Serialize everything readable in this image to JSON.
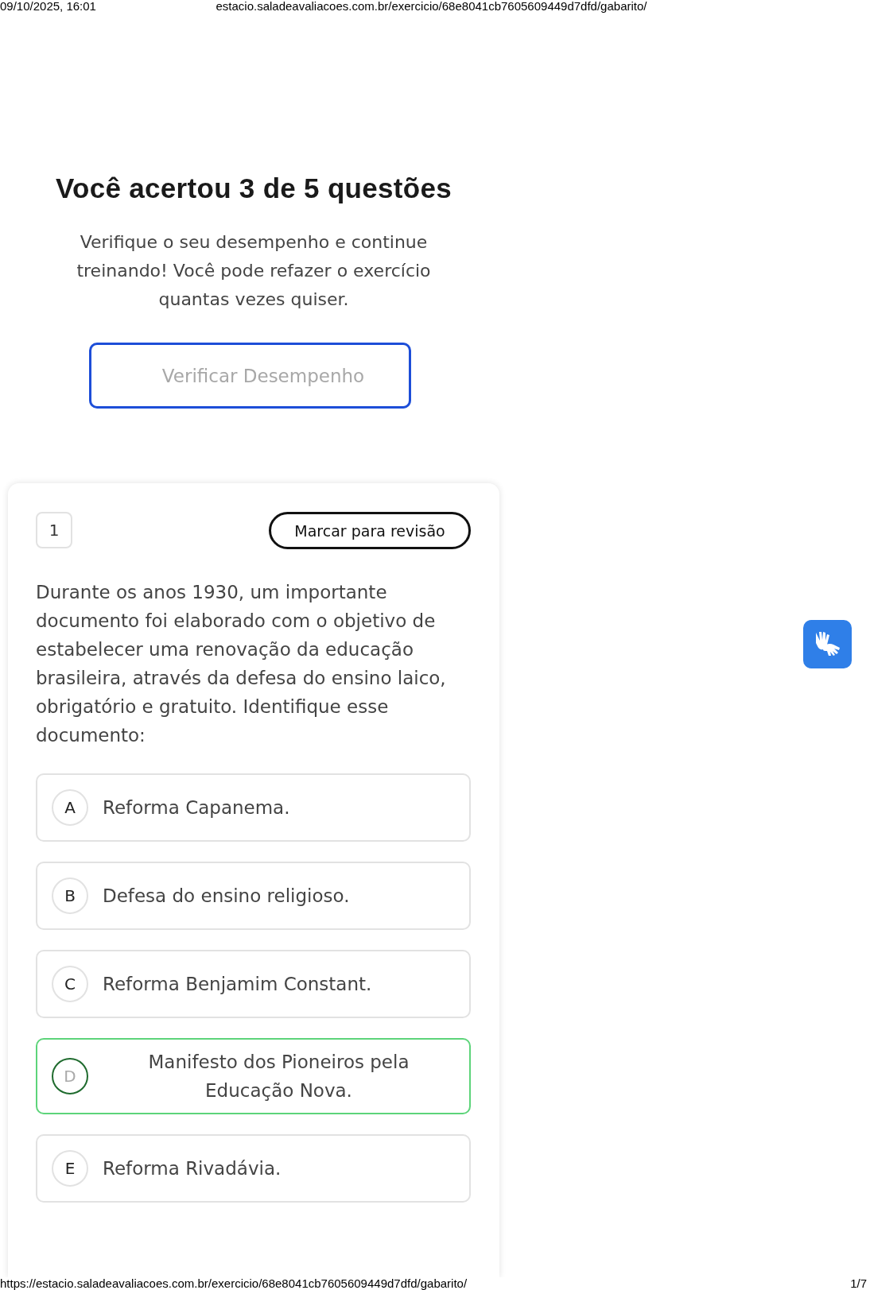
{
  "print_header": {
    "date": "09/10/2025, 16:01",
    "url": "estacio.saladeavaliacoes.com.br/exercicio/68e8041cb7605609449d7dfd/gabarito/"
  },
  "result": {
    "title": "Você acertou 3 de 5 questões",
    "message": "Verifique o seu desempenho e continue treinando! Você pode refazer o exercício quantas vezes quiser.",
    "button": "Verificar Desempenho"
  },
  "question": {
    "number": "1",
    "review_button": "Marcar para revisão",
    "text": "Durante os anos 1930, um importante documento foi elaborado com o objetivo de estabelecer uma renovação da educação brasileira, através da defesa do ensino laico, obrigatório e gratuito. Identifique esse documento:",
    "options": [
      {
        "letter": "A",
        "text": "Reforma Capanema.",
        "correct": false
      },
      {
        "letter": "B",
        "text": "Defesa do ensino religioso.",
        "correct": false
      },
      {
        "letter": "C",
        "text": "Reforma Benjamim Constant.",
        "correct": false
      },
      {
        "letter": "D",
        "text": "Manifesto dos Pioneiros pela Educação Nova.",
        "correct": true
      },
      {
        "letter": "E",
        "text": "Reforma Rivadávia.",
        "correct": false
      }
    ]
  },
  "print_footer": {
    "url": "https://estacio.saladeavaliacoes.com.br/exercicio/68e8041cb7605609449d7dfd/gabarito/",
    "page": "1/7"
  }
}
